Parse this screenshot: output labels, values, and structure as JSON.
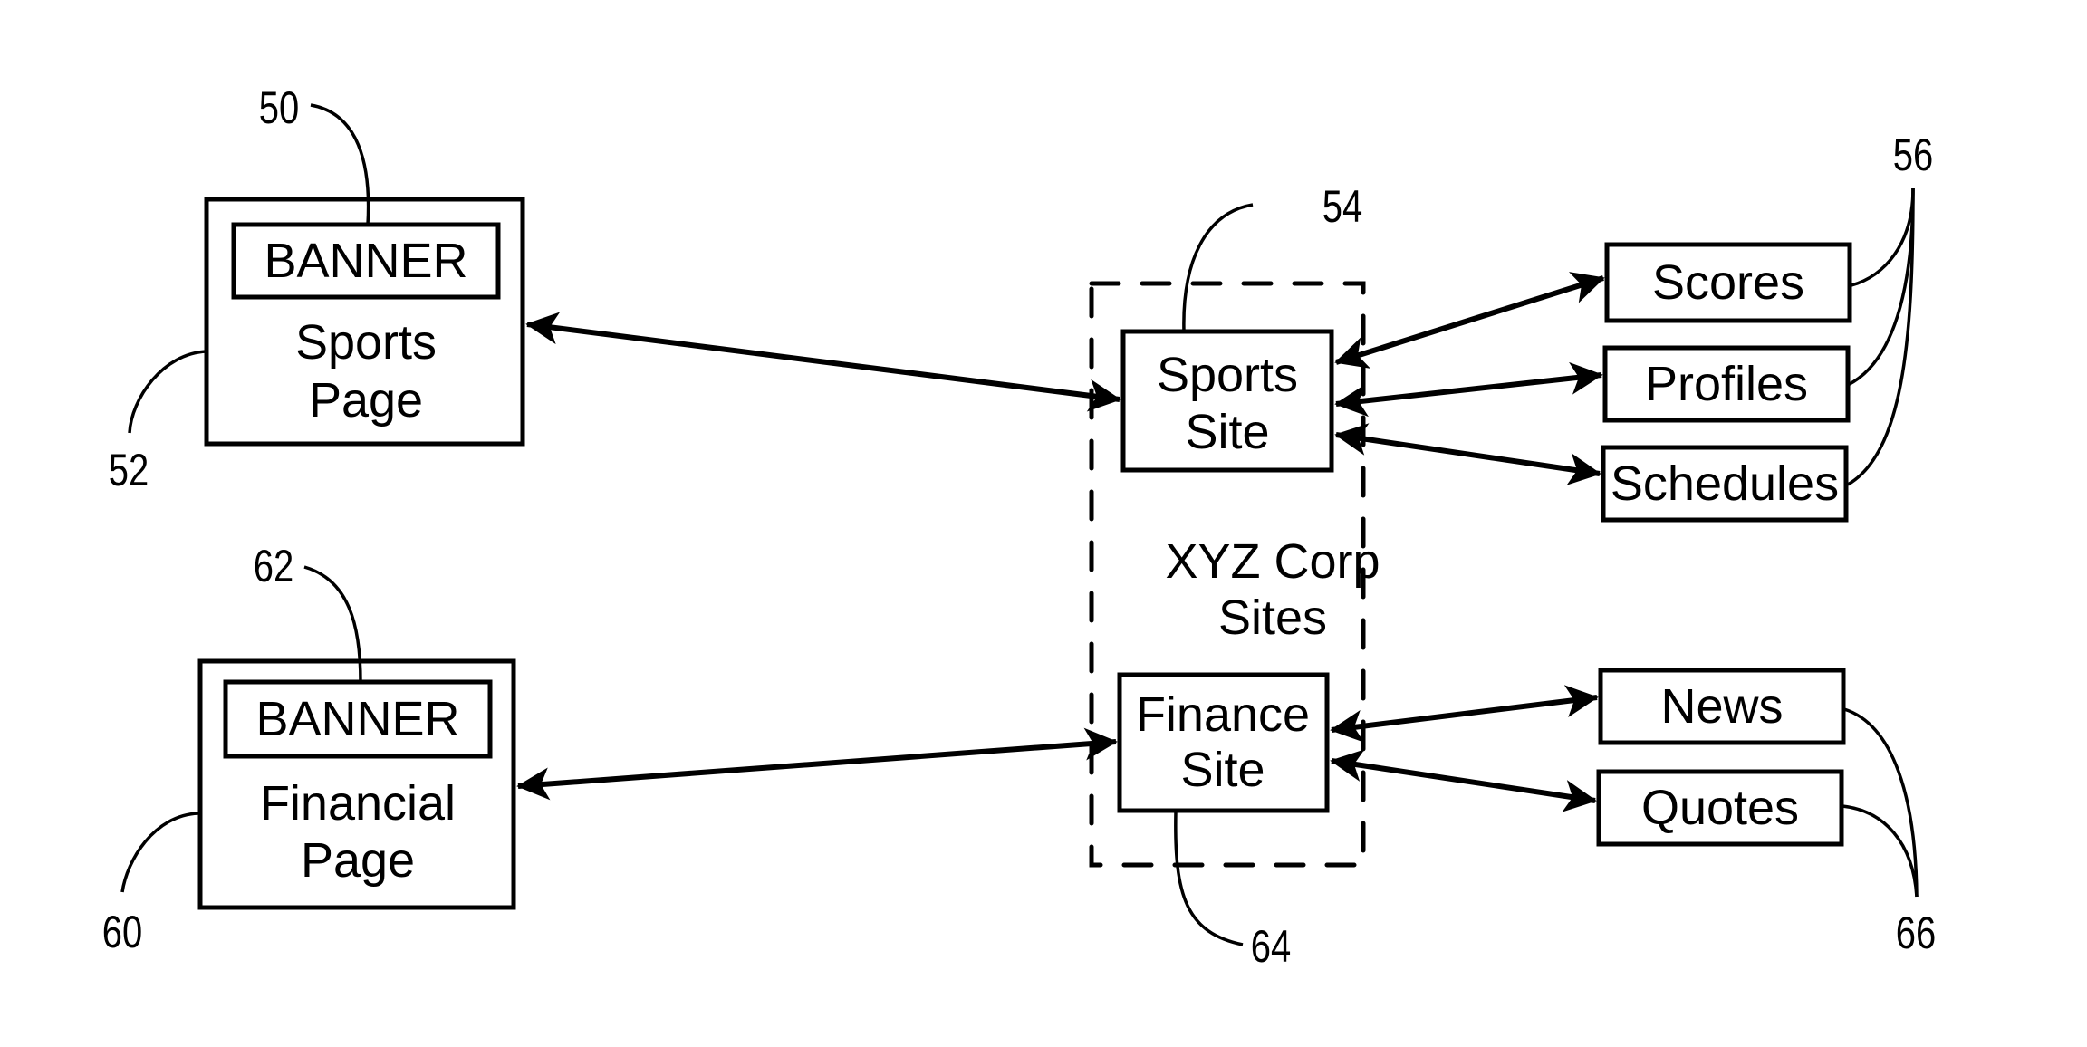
{
  "diagram": {
    "pages": [
      {
        "id": "sports-page",
        "banner": "BANNER",
        "title_line1": "Sports",
        "title_line2": "Page",
        "banner_ref": "50",
        "page_ref": "52"
      },
      {
        "id": "financial-page",
        "banner": "BANNER",
        "title_line1": "Financial",
        "title_line2": "Page",
        "banner_ref": "62",
        "page_ref": "60"
      }
    ],
    "group": {
      "label_line1": "XYZ Corp",
      "label_line2": "Sites",
      "sites": [
        {
          "id": "sports-site",
          "line1": "Sports",
          "line2": "Site",
          "ref": "54"
        },
        {
          "id": "finance-site",
          "line1": "Finance",
          "line2": "Site",
          "ref": "64"
        }
      ]
    },
    "sports_subsites": {
      "ref": "56",
      "items": [
        "Scores",
        "Profiles",
        "Schedules"
      ]
    },
    "finance_subsites": {
      "ref": "66",
      "items": [
        "News",
        "Quotes"
      ]
    },
    "connections": [
      {
        "from": "Sports Page",
        "to": "Sports Site",
        "type": "bidirectional"
      },
      {
        "from": "Financial Page",
        "to": "Finance Site",
        "type": "bidirectional"
      },
      {
        "from": "Sports Site",
        "to": "Scores",
        "type": "bidirectional"
      },
      {
        "from": "Sports Site",
        "to": "Profiles",
        "type": "bidirectional"
      },
      {
        "from": "Sports Site",
        "to": "Schedules",
        "type": "bidirectional"
      },
      {
        "from": "Finance Site",
        "to": "News",
        "type": "bidirectional"
      },
      {
        "from": "Finance Site",
        "to": "Quotes",
        "type": "bidirectional"
      }
    ]
  }
}
